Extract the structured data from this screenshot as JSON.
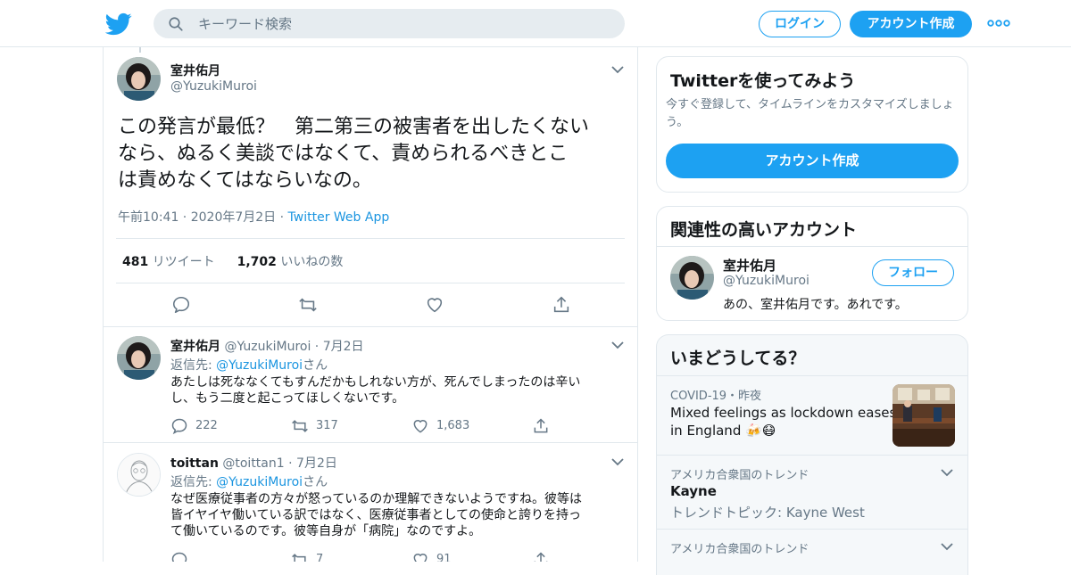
{
  "search": {
    "placeholder": "キーワード検索"
  },
  "header": {
    "login_label": "ログイン",
    "signup_label": "アカウント作成"
  },
  "tweet": {
    "author_name": "室井佑月",
    "author_handle": "@YuzukiMuroi",
    "text_line1": "この発言が最低？　第二第三の被害者を出したくない",
    "text_line2": "なら、ぬるく美談ではなくて、責められるべきとこ",
    "text_line3": "は責めなくてはならいなの。",
    "time": "午前10:41",
    "date": "2020年7月2日",
    "app": "Twitter Web App",
    "retweet_count": "481",
    "retweet_label": "リツイート",
    "like_count": "1,702",
    "like_label": "いいねの数"
  },
  "replies": [
    {
      "author_name": "室井佑月",
      "author_handle": "@YuzukiMuroi",
      "date": "7月2日",
      "reply_to_prefix": "返信先: ",
      "reply_to_handle": "@YuzukiMuroi",
      "reply_to_suffix": "さん",
      "text_line1": "あたしは死ななくてもすんだかもしれない方が、死んでしまったのは辛い",
      "text_line2": "し、もう二度と起こってほしくないです。",
      "reply_count": "222",
      "retweet_count": "317",
      "like_count": "1,683"
    },
    {
      "author_name": "toittan",
      "author_handle": "@toittan1",
      "date": "7月2日",
      "reply_to_prefix": "返信先: ",
      "reply_to_handle": "@YuzukiMuroi",
      "reply_to_suffix": "さん",
      "text_line1": "なぜ医療従事者の方々が怒っているのか理解できないようですね。彼等は",
      "text_line2": "皆イヤイヤ働いている訳ではなく、医療従事者としての使命と誇りを持っ",
      "text_line3": "て働いているのです。彼等自身が「病院」なのですよ。",
      "reply_count": "",
      "retweet_count": "7",
      "like_count": "91"
    }
  ],
  "signup_card": {
    "title": "Twitterを使ってみよう",
    "subtitle": "今すぐ登録して、タイムラインをカスタマイズしましょう。",
    "button": "アカウント作成"
  },
  "related_card": {
    "title": "関連性の高いアカウント",
    "name": "室井佑月",
    "handle": "@YuzukiMuroi",
    "bio": "あの、室井佑月です。あれです。",
    "follow": "フォロー"
  },
  "trends_card": {
    "title": "いまどうしてる？",
    "items": [
      {
        "meta": "COVID-19・昨夜",
        "name_line1": "Mixed feelings as lockdown eases",
        "name_line2": "in England 🍻😷"
      },
      {
        "meta": "アメリカ合衆国のトレンド",
        "name": "Kayne",
        "sub": "トレンドトピック: Kayne West"
      },
      {
        "meta": "アメリカ合衆国のトレンド"
      }
    ]
  },
  "colors": {
    "accent": "#1da1f2",
    "link": "#1b95e0",
    "muted": "#657786",
    "border": "#e1e8ed"
  }
}
